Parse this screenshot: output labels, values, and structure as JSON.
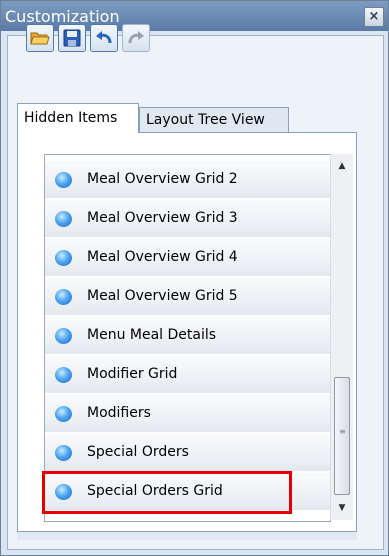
{
  "window": {
    "title": "Customization",
    "close_label": "×"
  },
  "toolbar": {
    "buttons": [
      {
        "icon": "open-folder-icon",
        "enabled": true
      },
      {
        "icon": "save-icon",
        "enabled": true
      },
      {
        "icon": "undo-icon",
        "enabled": true
      },
      {
        "icon": "redo-icon",
        "enabled": false
      }
    ]
  },
  "tabs": [
    {
      "label": "Hidden Items",
      "active": true
    },
    {
      "label": "Layout Tree View",
      "active": false
    }
  ],
  "hidden_items": {
    "items": [
      "Meal Overview Grid 2",
      "Meal Overview Grid 3",
      "Meal Overview Grid 4",
      "Meal Overview Grid 5",
      "Menu Meal Details",
      "Modifier Grid",
      "Modifiers",
      "Special Orders",
      "Special Orders Grid"
    ],
    "highlighted_item": "Special Orders Grid",
    "item_icon": "blue-bubble-icon"
  },
  "scrollbar": {
    "up_arrow": "▲",
    "down_arrow": "▼"
  },
  "colors": {
    "highlight": "#e60000",
    "titlebar": "#6a89b4"
  }
}
